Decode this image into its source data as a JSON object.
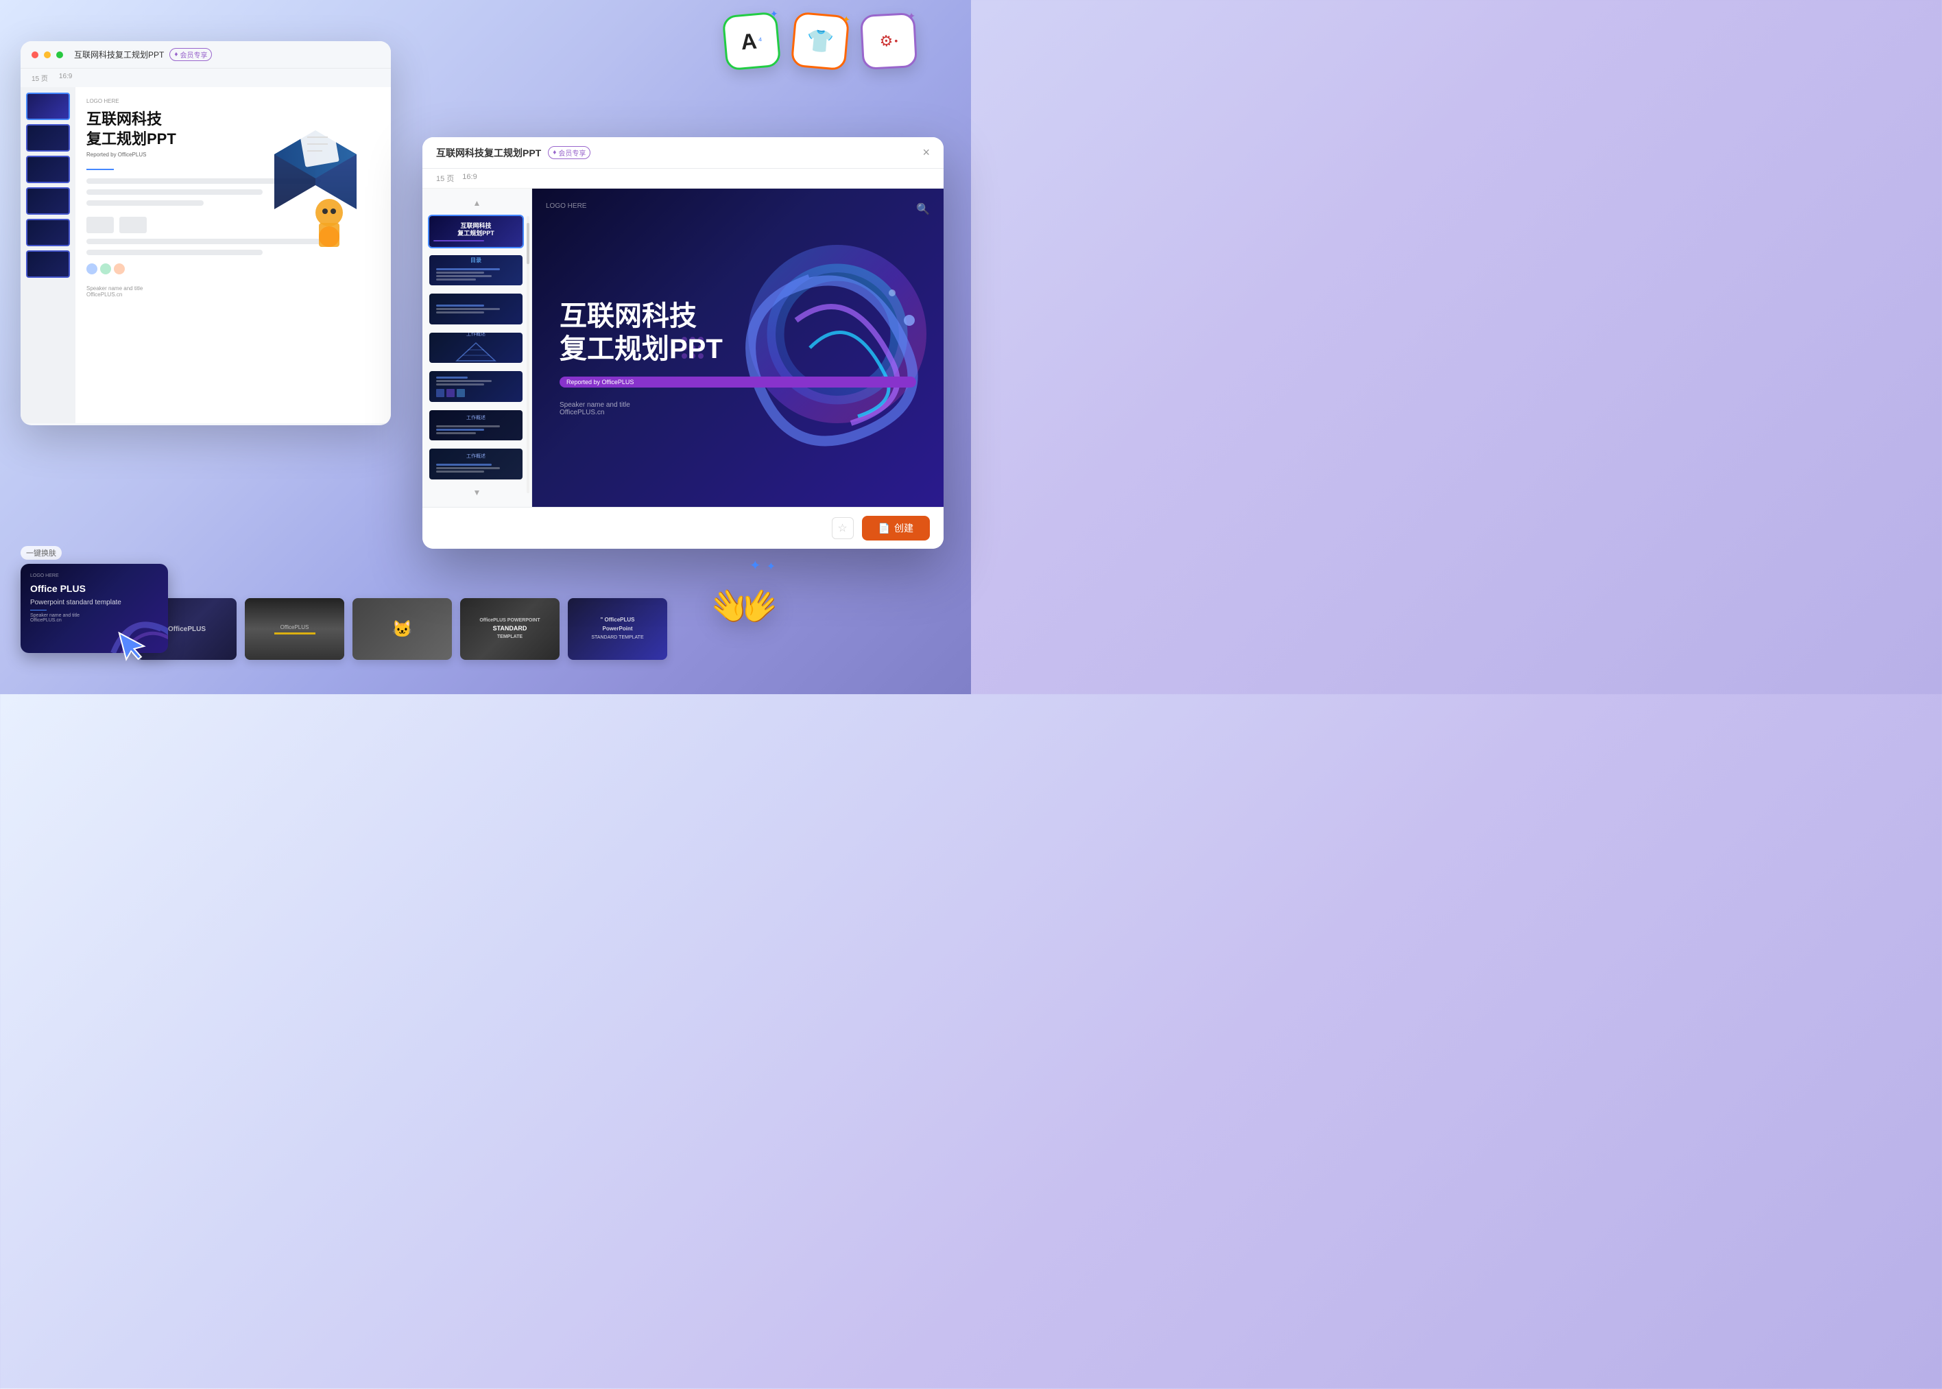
{
  "background": {
    "gradient": "linear-gradient(135deg, #dce8ff, #b0c0f0, #9090d8)"
  },
  "topIcons": [
    {
      "id": "font-icon",
      "symbol": "A",
      "borderColor": "#22cc44",
      "sparkle": "✦",
      "label": "font-style-icon"
    },
    {
      "id": "shirt-icon",
      "symbol": "👕",
      "borderColor": "#ff6600",
      "label": "template-style-icon"
    },
    {
      "id": "settings-icon",
      "symbol": "⚙",
      "borderColor": "#9966cc",
      "label": "settings-icon"
    }
  ],
  "backWindow": {
    "title": "互联网科技复工规划PPT",
    "memberBadge": "会员专享",
    "meta": {
      "pages": "15 页",
      "ratio": "16:9"
    },
    "mainTitle": "互联网科技\n复工规划PPT",
    "subTitle": "Reported by OfficePLUS",
    "logoText": "LOGO HERE",
    "speakerText": "Speaker name and title\nOfficePLUS.cn"
  },
  "swapPanel": {
    "label": "一键换肤",
    "card": {
      "logoText": "LOGO HERE",
      "title": "Office PLUS\nPowerpoint standard template",
      "speakerText": "Speaker name and title\nOfficePLUS.cn"
    }
  },
  "templateCards": [
    {
      "id": "dark-tech",
      "type": "dark",
      "text": "OfficePLUS"
    },
    {
      "id": "city",
      "type": "city",
      "text": ""
    },
    {
      "id": "cat",
      "type": "cat",
      "text": "🐱"
    },
    {
      "id": "construction",
      "type": "construction",
      "lines": [
        "OfficePLUS POWERPOINT",
        "STANDARD",
        "TEMPLATE"
      ]
    },
    {
      "id": "ppt-blue",
      "type": "ppt",
      "lines": [
        "OfficePLUS",
        "PowerPoint",
        "STANDARD TEMPLATE"
      ]
    }
  ],
  "frontWindow": {
    "title": "互联网科技复工规划PPT",
    "memberBadge": "会员专享",
    "closeLabel": "×",
    "meta": {
      "pages": "15 页",
      "ratio": "16:9"
    },
    "preview": {
      "logoText": "LOGO HERE",
      "searchIcon": "🔍",
      "mainTitle": "互联网科技\n复工规划PPT",
      "badge": "Reported by OfficePLUS",
      "speakerLine1": "Speaker name and title",
      "speakerLine2": "OfficePLUS.cn"
    },
    "thumbnails": [
      {
        "id": 1,
        "label": "",
        "title": "互联网科技\n复工规划PPT",
        "selected": true
      },
      {
        "id": 2,
        "label": "目录",
        "title": "",
        "type": "menu"
      },
      {
        "id": 3,
        "label": "",
        "title": "",
        "type": "content"
      },
      {
        "id": 4,
        "label": "工作概述",
        "title": "",
        "type": "pyramid"
      },
      {
        "id": 5,
        "label": "",
        "title": "",
        "type": "chart"
      },
      {
        "id": 6,
        "label": "工作概述",
        "title": "",
        "type": "content2"
      },
      {
        "id": 7,
        "label": "",
        "title": "",
        "type": "content3"
      }
    ],
    "footer": {
      "starLabel": "☆",
      "createLabel": "创建",
      "createIcon": "📄"
    }
  },
  "clapHands": {
    "emoji": "👐",
    "sparkles": "✦ ✦"
  }
}
